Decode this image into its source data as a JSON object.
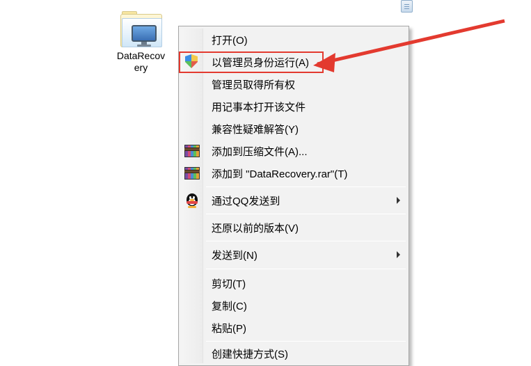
{
  "desktop": {
    "app_label": "DataRecov\nery"
  },
  "menu": {
    "open": "打开(O)",
    "run_as_admin": "以管理员身份运行(A)",
    "admin_take_ownership": "管理员取得所有权",
    "open_with_notepad": "用记事本打开该文件",
    "compat_troubleshoot": "兼容性疑难解答(Y)",
    "add_to_archive": "添加到压缩文件(A)...",
    "add_to_named_rar": "添加到 \"DataRecovery.rar\"(T)",
    "send_via_qq": "通过QQ发送到",
    "restore_previous": "还原以前的版本(V)",
    "send_to": "发送到(N)",
    "cut": "剪切(T)",
    "copy": "复制(C)",
    "paste": "粘贴(P)",
    "create_shortcut": "创建快捷方式(S)"
  },
  "icons": {
    "folder": "folder-monitor-icon",
    "shield": "uac-shield-icon",
    "rar": "winrar-icon",
    "qq": "qq-penguin-icon"
  },
  "colors": {
    "highlight_red": "#e33a2f"
  }
}
